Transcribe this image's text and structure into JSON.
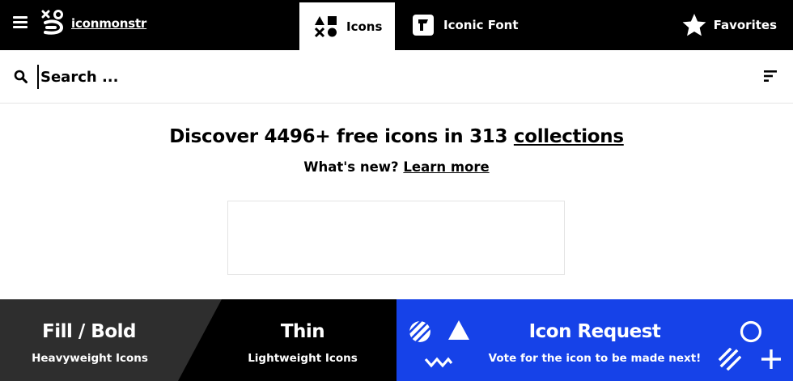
{
  "header": {
    "logo_text": "iconmonstr",
    "tabs": [
      {
        "label": "Icons",
        "active": true
      },
      {
        "label": "Iconic Font",
        "active": false
      }
    ],
    "favorites_label": "Favorites"
  },
  "search": {
    "placeholder": "Search ..."
  },
  "hero": {
    "headline_prefix": "Discover 4496+ free icons in 313 ",
    "headline_link": "collections",
    "subline_prefix": "What's new? ",
    "subline_link": "Learn more"
  },
  "panels": {
    "fill": {
      "title": "Fill / Bold",
      "subtitle": "Heavyweight Icons"
    },
    "thin": {
      "title": "Thin",
      "subtitle": "Lightweight Icons"
    },
    "request": {
      "title": "Icon Request",
      "subtitle": "Vote for the icon to be made next!"
    }
  },
  "colors": {
    "nav_bg": "#000000",
    "request_blue": "#1642e8",
    "fill_gray": "#2e2e2e"
  }
}
